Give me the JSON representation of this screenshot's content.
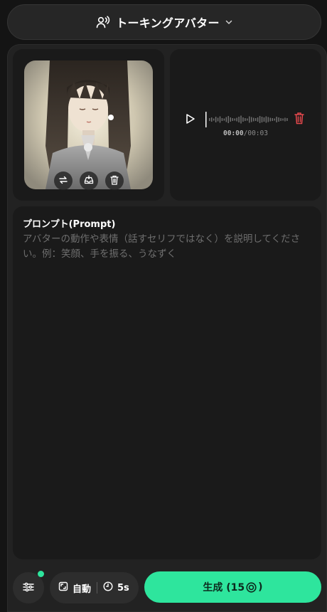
{
  "header": {
    "mode_label": "トーキングアバター"
  },
  "avatar": {
    "image_icon": "portrait-image"
  },
  "audio": {
    "current_time": "00:00",
    "separator": "/",
    "total_time": "00:03"
  },
  "prompt": {
    "title": "プロンプト(Prompt)",
    "placeholder": "アバターの動作や表情（話すセリフではなく）を説明してください。例：笑顔、手を振る、うなずく",
    "value": ""
  },
  "footer": {
    "aspect_label": "自動",
    "duration_label": "5s",
    "generate_label": "生成 (15",
    "generate_suffix": ")"
  },
  "colors": {
    "accent": "#2ee59d",
    "delete_red": "#e5484d",
    "background": "#141414",
    "card": "#1a1a1a"
  }
}
